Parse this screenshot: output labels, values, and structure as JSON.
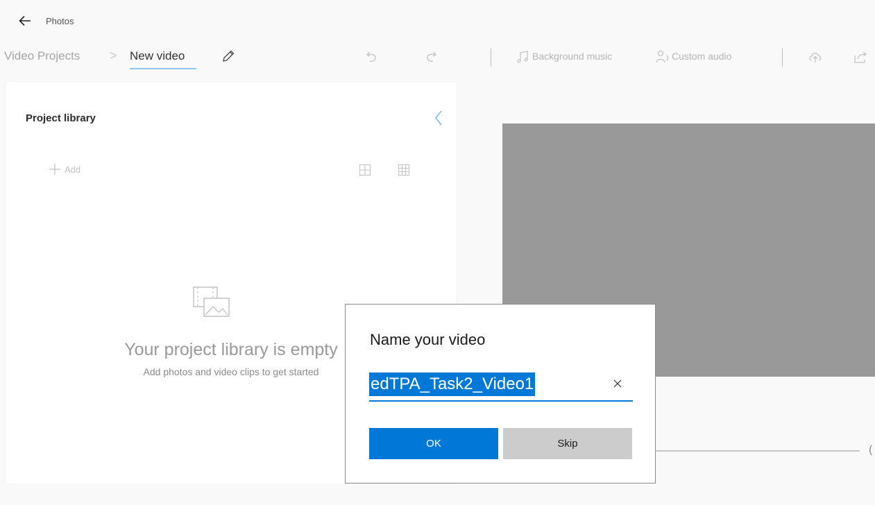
{
  "app": {
    "title": "Photos"
  },
  "breadcrumb": {
    "parent": "Video Projects",
    "separator": ">",
    "current": "New video"
  },
  "toolbar": {
    "background_music_label": "Background music",
    "custom_audio_label": "Custom audio",
    "icons": [
      "undo-icon",
      "redo-icon",
      "music-note-icon",
      "person-audio-icon",
      "cloud-upload-icon",
      "share-icon"
    ]
  },
  "library": {
    "title": "Project library",
    "add_label": "Add",
    "empty_title": "Your project library is empty",
    "empty_subtitle": "Add photos and video clips to get started"
  },
  "preview": {
    "trailing_label": "("
  },
  "dialog": {
    "title": "Name your video",
    "input_value": "edTPA_Task2_Video1",
    "ok_label": "OK",
    "skip_label": "Skip"
  },
  "colors": {
    "accent": "#0078d7",
    "preview_bg": "#999999",
    "page_bg": "#f9f9f9"
  }
}
